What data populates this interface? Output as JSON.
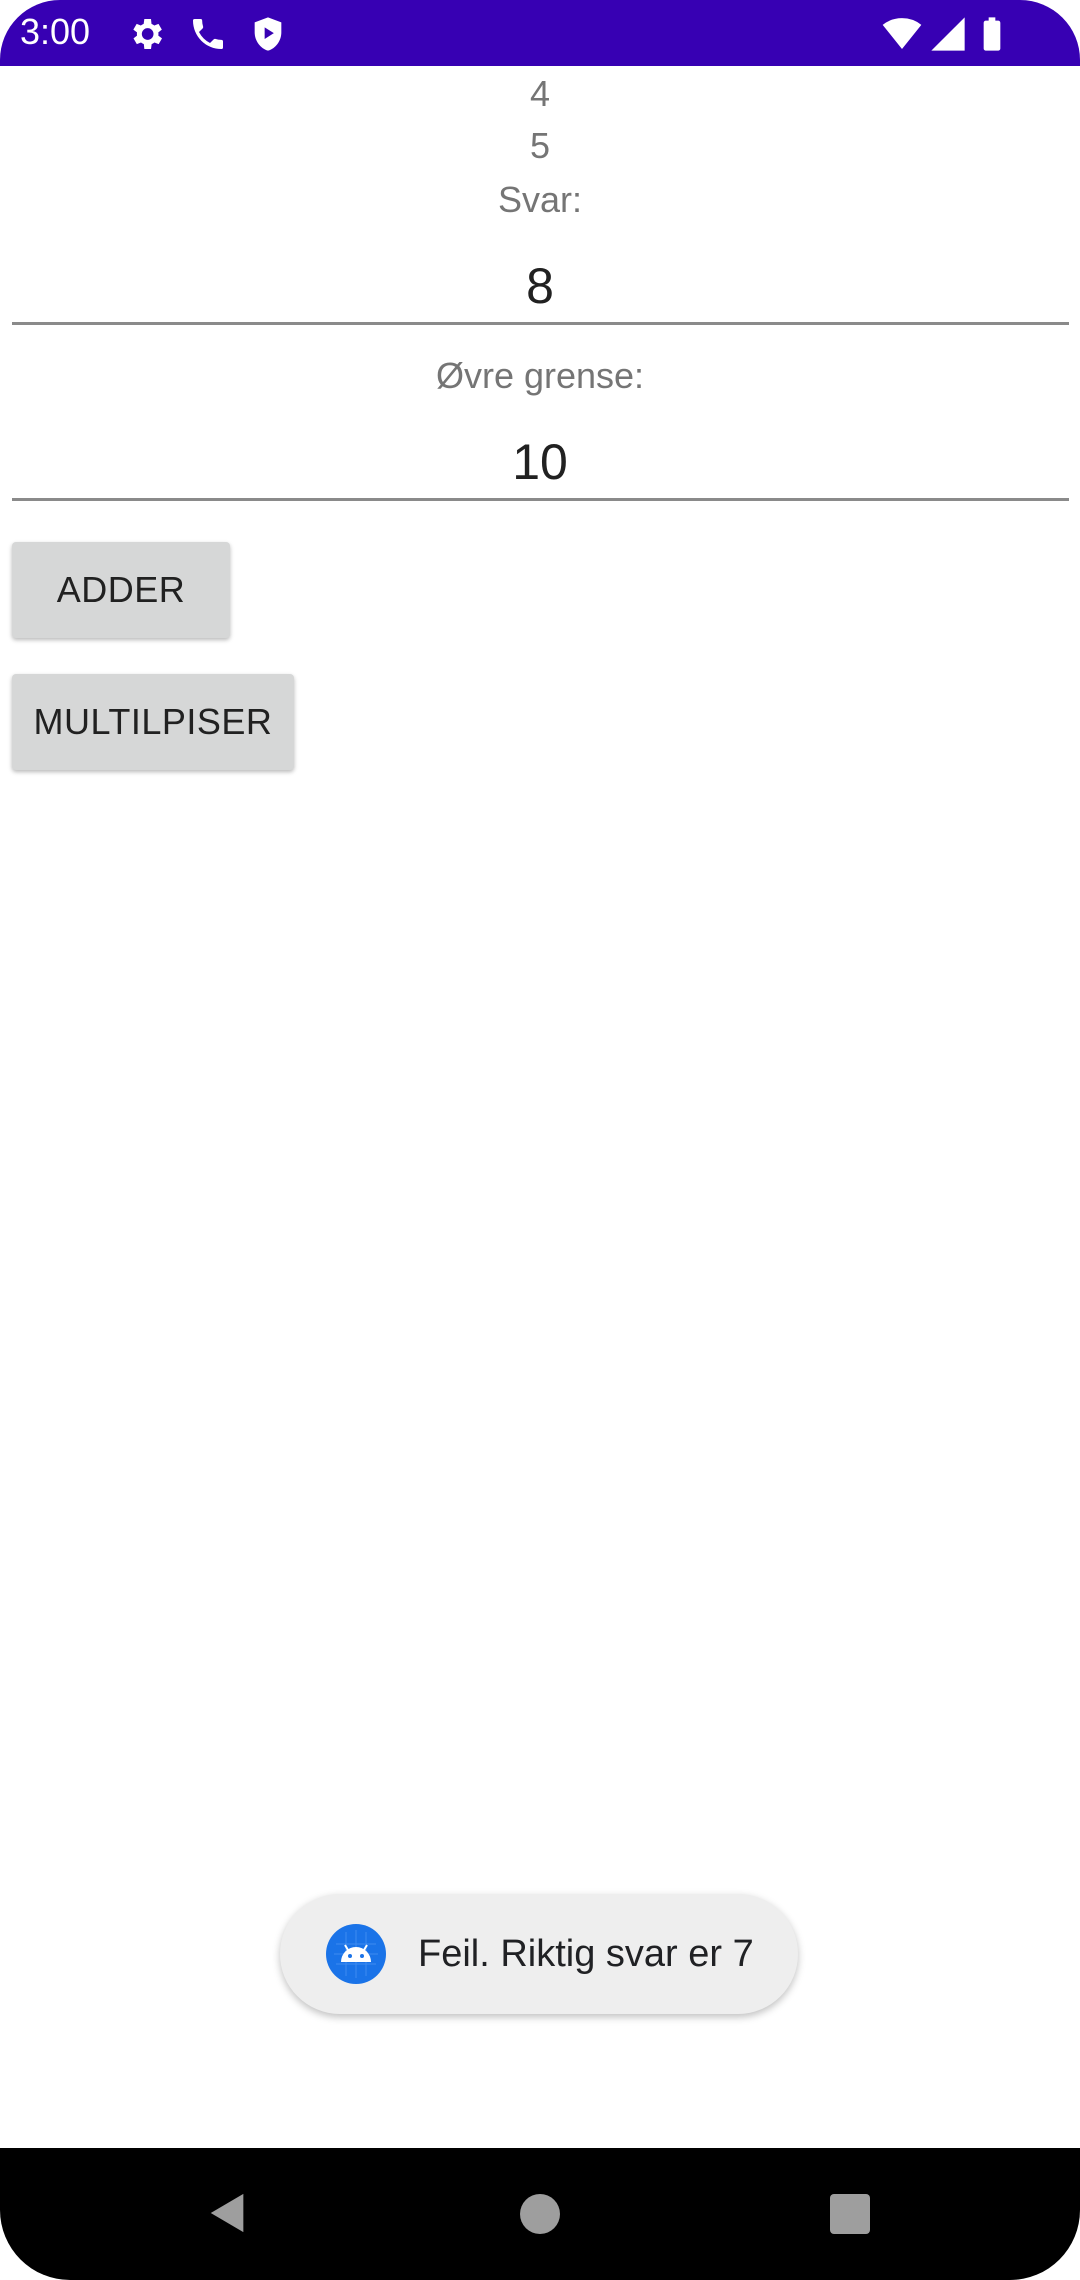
{
  "status_bar": {
    "time": "3:00",
    "left_icons": [
      "gear-icon",
      "phone-icon",
      "shield-play-icon"
    ],
    "right_icons": [
      "wifi-icon",
      "cell-signal-icon",
      "battery-icon"
    ],
    "background": "#3700b3"
  },
  "numbers": [
    "4",
    "5"
  ],
  "answer": {
    "label": "Svar:",
    "value": "8"
  },
  "upper_limit": {
    "label": "Øvre grense:",
    "value": "10"
  },
  "buttons": {
    "add": "ADDER",
    "multiply": "MULTILPISER"
  },
  "toast": {
    "icon": "android-icon",
    "message": "Feil. Riktig svar er 7"
  },
  "nav_bar": {
    "back": "back-icon",
    "home": "home-icon",
    "recents": "recents-icon"
  }
}
